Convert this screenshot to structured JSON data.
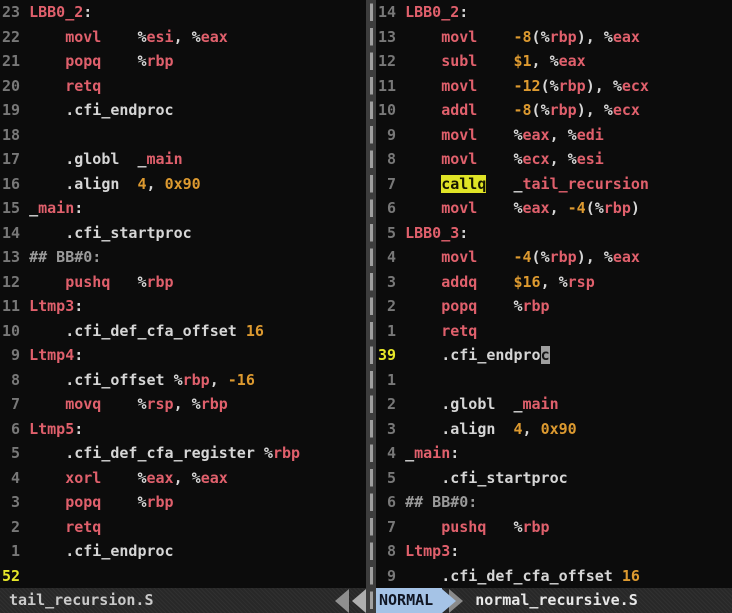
{
  "colors": {
    "background": "#0c0c0c",
    "red": "#e0606c",
    "orange": "#dd9a30",
    "white_text": "#d6d6d6",
    "comment_gray": "#9a9a9a",
    "line_number_gray": "#787878",
    "current_line_number_yellow": "#e7e729",
    "search_highlight_bg": "#e0e426",
    "cursor_block_bg": "#9f9f9f",
    "mode_segment_bg": "#a5c3e6",
    "statusbar_bg": "#282828"
  },
  "status_left": {
    "file": "tail_recursion.S"
  },
  "status_right": {
    "mode": "NORMAL",
    "file": "normal_recursive.S"
  },
  "left_pane": {
    "rows": [
      {
        "n": "23",
        "t": [
          [
            "LBB0_2",
            "r"
          ],
          [
            ":",
            "w"
          ]
        ]
      },
      {
        "n": "22",
        "t": [
          [
            "    ",
            "w"
          ],
          [
            "movl",
            "r"
          ],
          [
            "    ",
            "w"
          ],
          [
            "%",
            "w"
          ],
          [
            "esi",
            "r"
          ],
          [
            ", ",
            "w"
          ],
          [
            "%",
            "w"
          ],
          [
            "eax",
            "r"
          ]
        ]
      },
      {
        "n": "21",
        "t": [
          [
            "    ",
            "w"
          ],
          [
            "popq",
            "r"
          ],
          [
            "    ",
            "w"
          ],
          [
            "%",
            "w"
          ],
          [
            "rbp",
            "r"
          ]
        ]
      },
      {
        "n": "20",
        "t": [
          [
            "    ",
            "w"
          ],
          [
            "retq",
            "r"
          ]
        ]
      },
      {
        "n": "19",
        "t": [
          [
            "    .cfi_endproc",
            "w"
          ]
        ]
      },
      {
        "n": "18",
        "t": []
      },
      {
        "n": "17",
        "t": [
          [
            "    .globl  _",
            "w"
          ],
          [
            "main",
            "r"
          ]
        ]
      },
      {
        "n": "16",
        "t": [
          [
            "    .align  ",
            "w"
          ],
          [
            "4",
            "o"
          ],
          [
            ", ",
            "w"
          ],
          [
            "0x90",
            "o"
          ]
        ]
      },
      {
        "n": "15",
        "t": [
          [
            "_",
            "w"
          ],
          [
            "main",
            "r"
          ],
          [
            ":",
            "w"
          ]
        ]
      },
      {
        "n": "14",
        "t": [
          [
            "    .cfi_startproc",
            "w"
          ]
        ]
      },
      {
        "n": "13",
        "t": [
          [
            "## BB#0:",
            "g"
          ]
        ]
      },
      {
        "n": "12",
        "t": [
          [
            "    ",
            "w"
          ],
          [
            "pushq",
            "r"
          ],
          [
            "   ",
            "w"
          ],
          [
            "%",
            "w"
          ],
          [
            "rbp",
            "r"
          ]
        ]
      },
      {
        "n": "11",
        "t": [
          [
            "Ltmp3",
            "r"
          ],
          [
            ":",
            "w"
          ]
        ]
      },
      {
        "n": "10",
        "t": [
          [
            "    .cfi_def_cfa_offset ",
            "w"
          ],
          [
            "16",
            "o"
          ]
        ]
      },
      {
        "n": " 9",
        "t": [
          [
            "Ltmp4",
            "r"
          ],
          [
            ":",
            "w"
          ]
        ]
      },
      {
        "n": " 8",
        "t": [
          [
            "    .cfi_offset ",
            "w"
          ],
          [
            "%",
            "w"
          ],
          [
            "rbp",
            "r"
          ],
          [
            ", ",
            "w"
          ],
          [
            "-16",
            "o"
          ]
        ]
      },
      {
        "n": " 7",
        "t": [
          [
            "    ",
            "w"
          ],
          [
            "movq",
            "r"
          ],
          [
            "    ",
            "w"
          ],
          [
            "%",
            "w"
          ],
          [
            "rsp",
            "r"
          ],
          [
            ", ",
            "w"
          ],
          [
            "%",
            "w"
          ],
          [
            "rbp",
            "r"
          ]
        ]
      },
      {
        "n": " 6",
        "t": [
          [
            "Ltmp5",
            "r"
          ],
          [
            ":",
            "w"
          ]
        ]
      },
      {
        "n": " 5",
        "t": [
          [
            "    .cfi_def_cfa_register ",
            "w"
          ],
          [
            "%",
            "w"
          ],
          [
            "rbp",
            "r"
          ]
        ]
      },
      {
        "n": " 4",
        "t": [
          [
            "    ",
            "w"
          ],
          [
            "xorl",
            "r"
          ],
          [
            "    ",
            "w"
          ],
          [
            "%",
            "w"
          ],
          [
            "eax",
            "r"
          ],
          [
            ", ",
            "w"
          ],
          [
            "%",
            "w"
          ],
          [
            "eax",
            "r"
          ]
        ]
      },
      {
        "n": " 3",
        "t": [
          [
            "    ",
            "w"
          ],
          [
            "popq",
            "r"
          ],
          [
            "    ",
            "w"
          ],
          [
            "%",
            "w"
          ],
          [
            "rbp",
            "r"
          ]
        ]
      },
      {
        "n": " 2",
        "t": [
          [
            "    ",
            "w"
          ],
          [
            "retq",
            "r"
          ]
        ]
      },
      {
        "n": " 1",
        "t": [
          [
            "    .cfi_endproc",
            "w"
          ]
        ]
      },
      {
        "n": "52",
        "cur": true,
        "t": []
      }
    ]
  },
  "right_pane": {
    "rows": [
      {
        "n": "14",
        "t": [
          [
            "LBB0_2",
            "r"
          ],
          [
            ":",
            "w"
          ]
        ]
      },
      {
        "n": "13",
        "t": [
          [
            "    ",
            "w"
          ],
          [
            "movl",
            "r"
          ],
          [
            "    ",
            "w"
          ],
          [
            "-8",
            "o"
          ],
          [
            "(",
            "w"
          ],
          [
            "%",
            "w"
          ],
          [
            "rbp",
            "r"
          ],
          [
            "), ",
            "w"
          ],
          [
            "%",
            "w"
          ],
          [
            "eax",
            "r"
          ]
        ]
      },
      {
        "n": "12",
        "t": [
          [
            "    ",
            "w"
          ],
          [
            "subl",
            "r"
          ],
          [
            "    ",
            "w"
          ],
          [
            "$1",
            "o"
          ],
          [
            ", ",
            "w"
          ],
          [
            "%",
            "w"
          ],
          [
            "eax",
            "r"
          ]
        ]
      },
      {
        "n": "11",
        "t": [
          [
            "    ",
            "w"
          ],
          [
            "movl",
            "r"
          ],
          [
            "    ",
            "w"
          ],
          [
            "-12",
            "o"
          ],
          [
            "(",
            "w"
          ],
          [
            "%",
            "w"
          ],
          [
            "rbp",
            "r"
          ],
          [
            "), ",
            "w"
          ],
          [
            "%",
            "w"
          ],
          [
            "ecx",
            "r"
          ]
        ]
      },
      {
        "n": "10",
        "t": [
          [
            "    ",
            "w"
          ],
          [
            "addl",
            "r"
          ],
          [
            "    ",
            "w"
          ],
          [
            "-8",
            "o"
          ],
          [
            "(",
            "w"
          ],
          [
            "%",
            "w"
          ],
          [
            "rbp",
            "r"
          ],
          [
            "), ",
            "w"
          ],
          [
            "%",
            "w"
          ],
          [
            "ecx",
            "r"
          ]
        ]
      },
      {
        "n": " 9",
        "t": [
          [
            "    ",
            "w"
          ],
          [
            "movl",
            "r"
          ],
          [
            "    ",
            "w"
          ],
          [
            "%",
            "w"
          ],
          [
            "eax",
            "r"
          ],
          [
            ", ",
            "w"
          ],
          [
            "%",
            "w"
          ],
          [
            "edi",
            "r"
          ]
        ]
      },
      {
        "n": " 8",
        "t": [
          [
            "    ",
            "w"
          ],
          [
            "movl",
            "r"
          ],
          [
            "    ",
            "w"
          ],
          [
            "%",
            "w"
          ],
          [
            "ecx",
            "r"
          ],
          [
            ", ",
            "w"
          ],
          [
            "%",
            "w"
          ],
          [
            "esi",
            "r"
          ]
        ]
      },
      {
        "n": " 7",
        "t": [
          [
            "    ",
            "w"
          ],
          [
            "callq",
            "search"
          ],
          [
            "   ",
            "w"
          ],
          [
            "_",
            "w"
          ],
          [
            "tail_recursion",
            "r"
          ]
        ]
      },
      {
        "n": " 6",
        "t": [
          [
            "    ",
            "w"
          ],
          [
            "movl",
            "r"
          ],
          [
            "    ",
            "w"
          ],
          [
            "%",
            "w"
          ],
          [
            "eax",
            "r"
          ],
          [
            ", ",
            "w"
          ],
          [
            "-4",
            "o"
          ],
          [
            "(",
            "w"
          ],
          [
            "%",
            "w"
          ],
          [
            "rbp",
            "r"
          ],
          [
            ")",
            "w"
          ]
        ]
      },
      {
        "n": " 5",
        "t": [
          [
            "LBB0_3",
            "r"
          ],
          [
            ":",
            "w"
          ]
        ]
      },
      {
        "n": " 4",
        "t": [
          [
            "    ",
            "w"
          ],
          [
            "movl",
            "r"
          ],
          [
            "    ",
            "w"
          ],
          [
            "-4",
            "o"
          ],
          [
            "(",
            "w"
          ],
          [
            "%",
            "w"
          ],
          [
            "rbp",
            "r"
          ],
          [
            "), ",
            "w"
          ],
          [
            "%",
            "w"
          ],
          [
            "eax",
            "r"
          ]
        ]
      },
      {
        "n": " 3",
        "t": [
          [
            "    ",
            "w"
          ],
          [
            "addq",
            "r"
          ],
          [
            "    ",
            "w"
          ],
          [
            "$16",
            "o"
          ],
          [
            ", ",
            "w"
          ],
          [
            "%",
            "w"
          ],
          [
            "rsp",
            "r"
          ]
        ]
      },
      {
        "n": " 2",
        "t": [
          [
            "    ",
            "w"
          ],
          [
            "popq",
            "r"
          ],
          [
            "    ",
            "w"
          ],
          [
            "%",
            "w"
          ],
          [
            "rbp",
            "r"
          ]
        ]
      },
      {
        "n": " 1",
        "t": [
          [
            "    ",
            "w"
          ],
          [
            "retq",
            "r"
          ]
        ]
      },
      {
        "n": "39",
        "cur": true,
        "t": [
          [
            "    .cfi_endpro",
            "w"
          ],
          [
            "c",
            "cursor"
          ]
        ]
      },
      {
        "n": " 1",
        "t": []
      },
      {
        "n": " 2",
        "t": [
          [
            "    .globl  _",
            "w"
          ],
          [
            "main",
            "r"
          ]
        ]
      },
      {
        "n": " 3",
        "t": [
          [
            "    .align  ",
            "w"
          ],
          [
            "4",
            "o"
          ],
          [
            ", ",
            "w"
          ],
          [
            "0x90",
            "o"
          ]
        ]
      },
      {
        "n": " 4",
        "t": [
          [
            "_",
            "w"
          ],
          [
            "main",
            "r"
          ],
          [
            ":",
            "w"
          ]
        ]
      },
      {
        "n": " 5",
        "t": [
          [
            "    .cfi_startproc",
            "w"
          ]
        ]
      },
      {
        "n": " 6",
        "t": [
          [
            "## BB#0:",
            "g"
          ]
        ]
      },
      {
        "n": " 7",
        "t": [
          [
            "    ",
            "w"
          ],
          [
            "pushq",
            "r"
          ],
          [
            "   ",
            "w"
          ],
          [
            "%",
            "w"
          ],
          [
            "rbp",
            "r"
          ]
        ]
      },
      {
        "n": " 8",
        "t": [
          [
            "Ltmp3",
            "r"
          ],
          [
            ":",
            "w"
          ]
        ]
      },
      {
        "n": " 9",
        "t": [
          [
            "    .cfi_def_cfa_offset ",
            "w"
          ],
          [
            "16",
            "o"
          ]
        ]
      }
    ]
  }
}
